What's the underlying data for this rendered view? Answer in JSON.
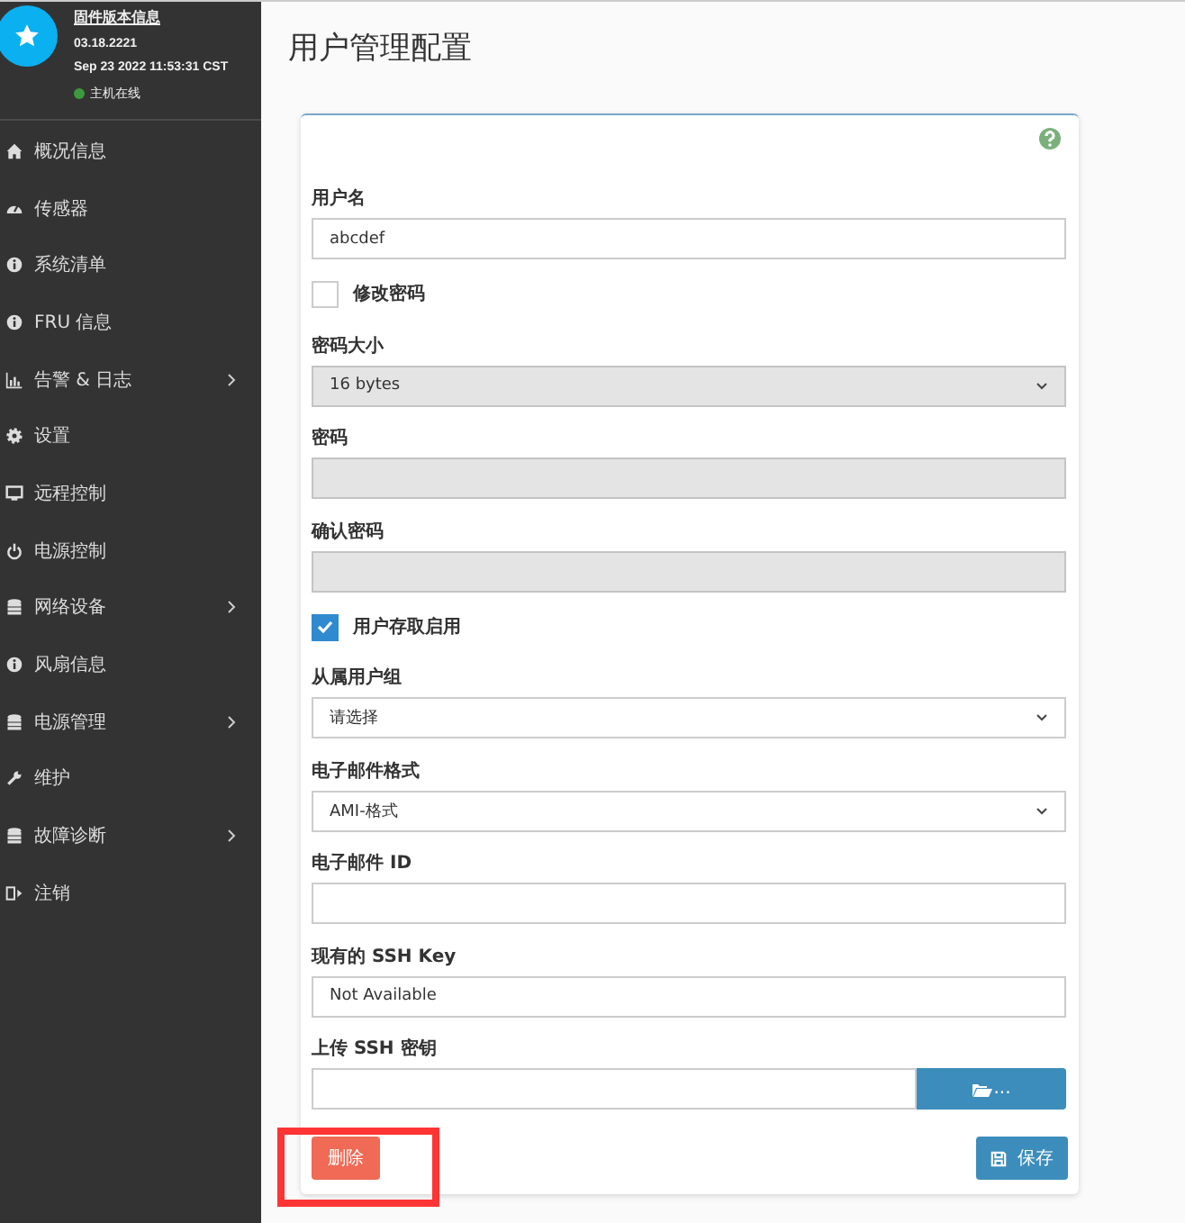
{
  "sidebar": {
    "header": {
      "title": "固件版本信息",
      "version": "03.18.2221",
      "datetime": "Sep 23 2022 11:53:31 CST",
      "status": {
        "text": "主机在线",
        "online": true
      }
    },
    "items": [
      {
        "label": "概况信息",
        "expandable": false
      },
      {
        "label": "传感器",
        "expandable": false
      },
      {
        "label": "系统清单",
        "expandable": false
      },
      {
        "label": "FRU 信息",
        "expandable": false
      },
      {
        "label": "告警 & 日志",
        "expandable": true
      },
      {
        "label": "设置",
        "expandable": false
      },
      {
        "label": "远程控制",
        "expandable": false
      },
      {
        "label": "电源控制",
        "expandable": false
      },
      {
        "label": "网络设备",
        "expandable": true
      },
      {
        "label": "风扇信息",
        "expandable": false
      },
      {
        "label": "电源管理",
        "expandable": true
      },
      {
        "label": "维护",
        "expandable": false
      },
      {
        "label": "故障诊断",
        "expandable": true
      },
      {
        "label": "注销",
        "expandable": false
      }
    ]
  },
  "page": {
    "title": "用户管理配置"
  },
  "form": {
    "fields": [
      {
        "kind": "input",
        "label": "用户名",
        "value": "abcdef",
        "disabled": false
      },
      {
        "kind": "checkbox",
        "label": "修改密码",
        "checked": false
      },
      {
        "kind": "select",
        "label": "密码大小",
        "value": "16 bytes",
        "disabled": true
      },
      {
        "kind": "input",
        "label": "密码",
        "disabled": true
      },
      {
        "kind": "input",
        "label": "确认密码",
        "disabled": true
      },
      {
        "kind": "checkbox",
        "label": "用户存取启用",
        "checked": true
      },
      {
        "kind": "select",
        "label": "从属用户组",
        "value": "请选择",
        "disabled": false
      },
      {
        "kind": "select",
        "label": "电子邮件格式",
        "value": "AMI-格式",
        "disabled": false
      },
      {
        "kind": "input",
        "label": "电子邮件 ID",
        "disabled": false
      },
      {
        "kind": "input",
        "label": "现有的 SSH Key",
        "value": "Not Available",
        "disabled": false
      },
      {
        "kind": "file",
        "label": "上传 SSH 密钥",
        "button": "..."
      }
    ],
    "delete_button": "删除",
    "save_button": "保存"
  }
}
